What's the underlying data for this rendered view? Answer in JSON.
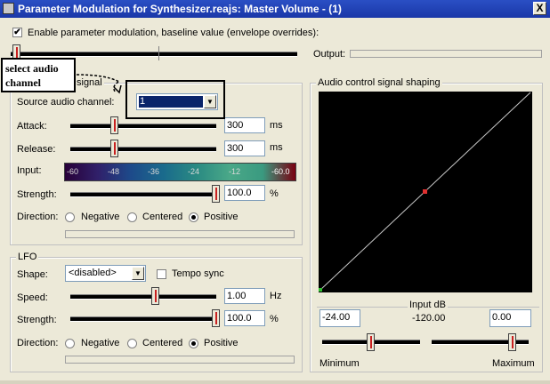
{
  "window": {
    "title": "Parameter Modulation for Synthesizer.reajs: Master Volume - (1)",
    "close_label": "X"
  },
  "baseline": {
    "enable_label": "Enable parameter modulation, baseline value (envelope overrides):",
    "enabled": true,
    "output_label": "Output:"
  },
  "callout": {
    "text": "select audio channel"
  },
  "audio_signal": {
    "group_label": "signal",
    "source_label": "Source audio channel:",
    "source_value": "1",
    "attack_label": "Attack:",
    "attack_value": "300",
    "attack_unit": "ms",
    "release_label": "Release:",
    "release_value": "300",
    "release_unit": "ms",
    "input_label": "Input:",
    "meter_ticks": [
      "-60",
      "-48",
      "-36",
      "-24",
      "-12",
      "-60.0"
    ],
    "strength_label": "Strength:",
    "strength_value": "100.0",
    "strength_unit": "%",
    "direction_label": "Direction:",
    "direction_options": [
      "Negative",
      "Centered",
      "Positive"
    ],
    "direction_selected": "Positive"
  },
  "lfo": {
    "group_label": "LFO",
    "shape_label": "Shape:",
    "shape_value": "<disabled>",
    "tempo_sync_label": "Tempo sync",
    "tempo_sync": false,
    "speed_label": "Speed:",
    "speed_value": "1.00",
    "speed_unit": "Hz",
    "strength_label": "Strength:",
    "strength_value": "100.0",
    "strength_unit": "%",
    "direction_label": "Direction:",
    "direction_options": [
      "Negative",
      "Centered",
      "Positive"
    ],
    "direction_selected": "Positive"
  },
  "shaping": {
    "group_label": "Audio control signal shaping",
    "input_db_label": "Input dB",
    "input_db_value": "-120.00",
    "min_value": "-24.00",
    "max_value": "0.00",
    "min_label": "Minimum",
    "max_label": "Maximum"
  },
  "colors": {
    "title_bg": "#1a37a8",
    "window_bg": "#ece9d8",
    "curve": "#c8c8c8",
    "midpoint": "#e03030",
    "endpoint": "#30c030"
  }
}
